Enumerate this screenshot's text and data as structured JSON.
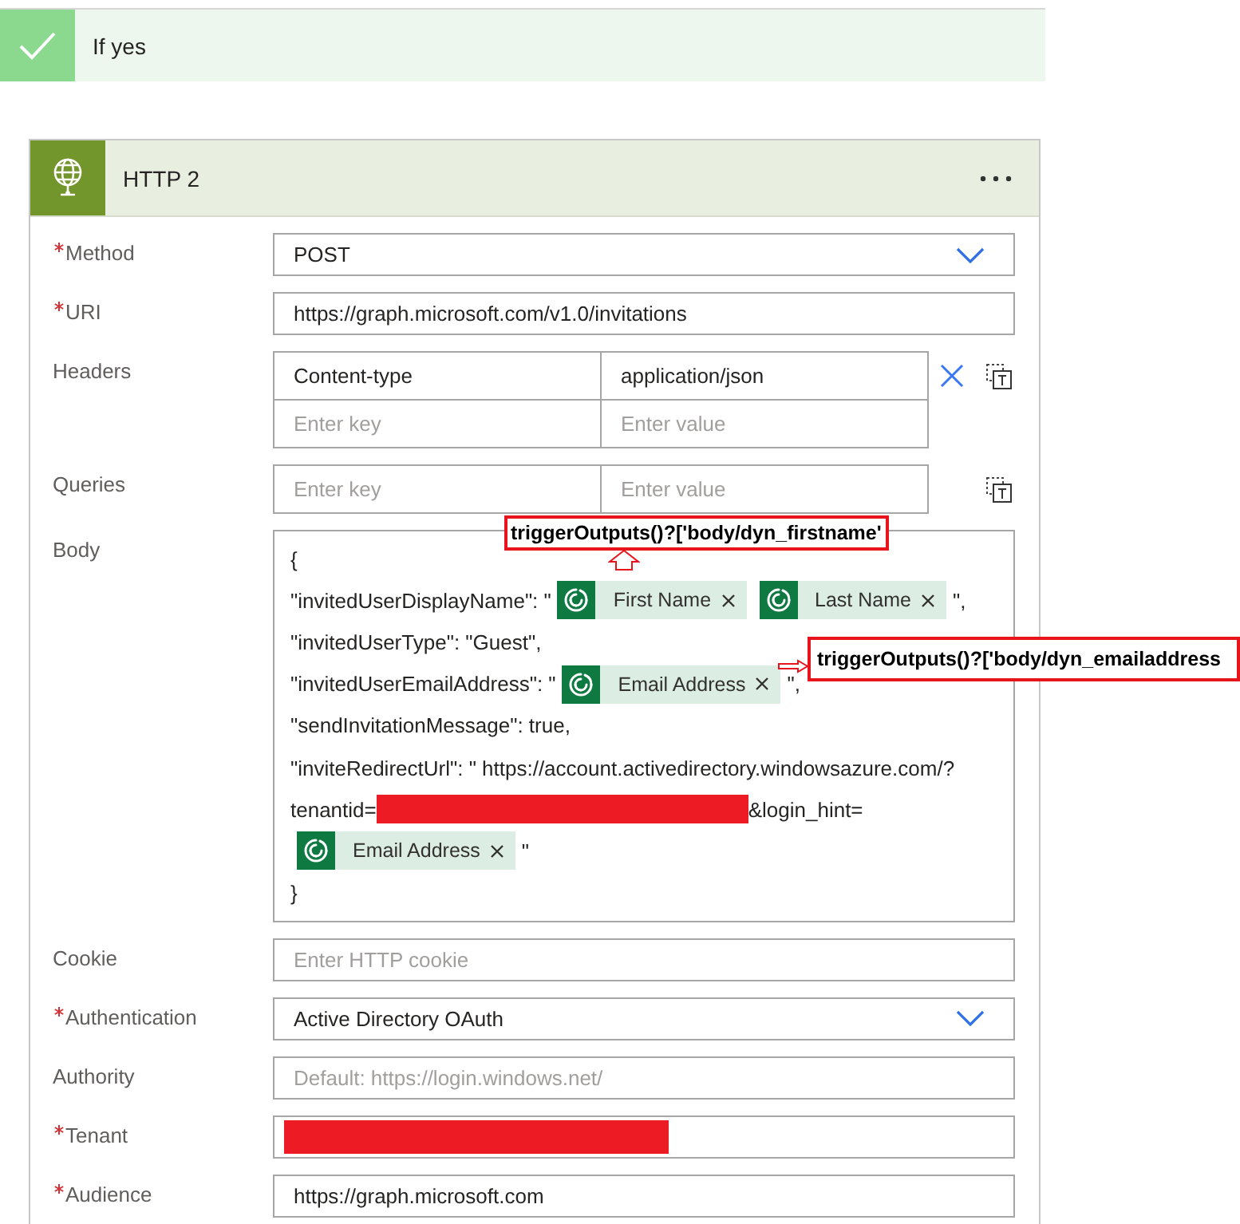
{
  "branch": {
    "title": "If yes"
  },
  "action": {
    "title": "HTTP 2",
    "fields": [
      {
        "kind": "select",
        "label": "Method",
        "required": true,
        "value": "POST"
      },
      {
        "kind": "input",
        "label": "URI",
        "required": true,
        "value": "https://graph.microsoft.com/v1.0/invitations"
      },
      {
        "kind": "pairs",
        "label": "Headers",
        "required": false,
        "rows": [
          {
            "key": "Content-type",
            "value": "application/json",
            "removable": true
          },
          {
            "key_placeholder": "Enter key",
            "value_placeholder": "Enter value",
            "removable": false
          }
        ]
      },
      {
        "kind": "pairs",
        "label": "Queries",
        "required": false,
        "rows": [
          {
            "key_placeholder": "Enter key",
            "value_placeholder": "Enter value",
            "removable": false
          }
        ]
      },
      {
        "kind": "body",
        "label": "Body",
        "required": false,
        "lines": [
          [
            {
              "kind": "text",
              "text": "{"
            }
          ],
          [
            {
              "kind": "text",
              "text": "\"invitedUserDisplayName\": \""
            },
            {
              "kind": "token",
              "text": "First Name"
            },
            {
              "kind": "token",
              "text": "Last Name"
            },
            {
              "kind": "text",
              "text": "\","
            }
          ],
          [
            {
              "kind": "text",
              "text": "\"invitedUserType\": \"Guest\","
            }
          ],
          [
            {
              "kind": "text",
              "text": "\"invitedUserEmailAddress\": \""
            },
            {
              "kind": "token",
              "text": "Email Address"
            },
            {
              "kind": "text",
              "text": "\","
            }
          ],
          [
            {
              "kind": "text",
              "text": "\"sendInvitationMessage\": true,"
            }
          ],
          [
            {
              "kind": "text",
              "text": "\"inviteRedirectUrl\": \" https://account.activedirectory.windowsazure.com/?"
            }
          ],
          [
            {
              "kind": "text",
              "text": "tenantid="
            },
            {
              "kind": "redacted"
            },
            {
              "kind": "text",
              "text": "&login_hint="
            }
          ],
          [
            {
              "kind": "token",
              "text": "Email Address"
            },
            {
              "kind": "text",
              "text": "\""
            }
          ],
          [
            {
              "kind": "text",
              "text": "}"
            }
          ]
        ]
      },
      {
        "kind": "input",
        "label": "Cookie",
        "required": false,
        "placeholder": "Enter HTTP cookie"
      },
      {
        "kind": "select",
        "label": "Authentication",
        "required": true,
        "value": "Active Directory OAuth"
      },
      {
        "kind": "input",
        "label": "Authority",
        "required": false,
        "placeholder": "Default: https://login.windows.net/"
      },
      {
        "kind": "redacted",
        "label": "Tenant",
        "required": true
      },
      {
        "kind": "input",
        "label": "Audience",
        "required": true,
        "value": "https://graph.microsoft.com"
      }
    ]
  },
  "annotations": [
    {
      "kind": "up",
      "text": "triggerOutputs()?['body/dyn_firstname'"
    },
    {
      "kind": "right",
      "text": "triggerOutputs()?['body/dyn_emailaddress"
    }
  ]
}
